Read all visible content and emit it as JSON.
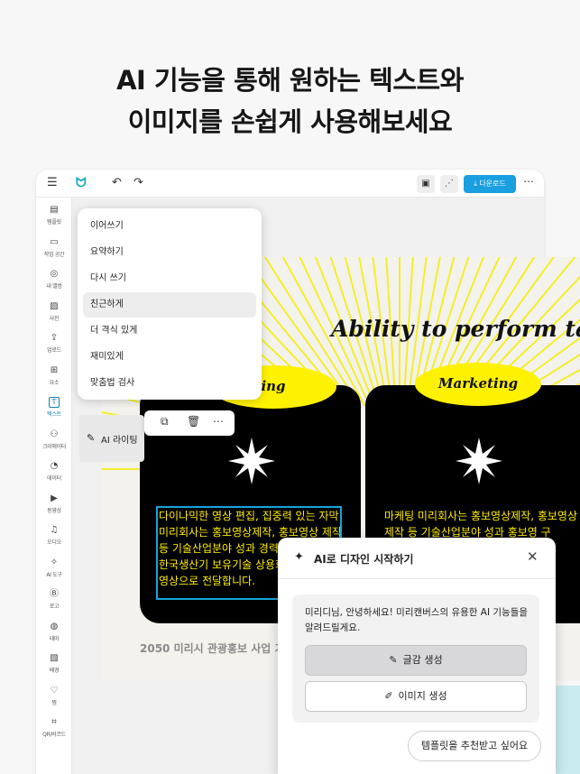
{
  "headline": {
    "line1": "AI 기능을 통해 원하는 텍스트와",
    "line2": "이미지를 손쉽게 사용해보세요"
  },
  "topbar": {
    "menu_icon": "☰",
    "logo_icon": "ᗢ",
    "undo_icon": "↶",
    "redo_icon": "↷",
    "save_icon": "▣",
    "share_icon": "⋰",
    "download_label": "⤓ 다운로드",
    "more_icon": "⋯"
  },
  "sidebar": {
    "items": [
      {
        "icon": "▤",
        "label": "템플릿"
      },
      {
        "icon": "▭",
        "label": "작업 공간"
      },
      {
        "icon": "◎",
        "label": "내 앨범"
      },
      {
        "icon": "▨",
        "label": "사진"
      },
      {
        "icon": "⇪",
        "label": "업로드"
      },
      {
        "icon": "⊞",
        "label": "요소"
      },
      {
        "icon": "T",
        "label": "텍스트"
      },
      {
        "icon": "⚇",
        "label": "크리에이터"
      },
      {
        "icon": "◔",
        "label": "데이터"
      },
      {
        "icon": "▶",
        "label": "동영상"
      },
      {
        "icon": "♫",
        "label": "오디오"
      },
      {
        "icon": "✧",
        "label": "AI 도구"
      },
      {
        "icon": "Ⓑ",
        "label": "로고"
      },
      {
        "icon": "◍",
        "label": "테마"
      },
      {
        "icon": "▧",
        "label": "배경"
      },
      {
        "icon": "♡",
        "label": "찜"
      },
      {
        "icon": "⌗",
        "label": "QR/바코드"
      }
    ]
  },
  "context_menu": {
    "items": [
      "이어쓰기",
      "요약하기",
      "다시 쓰기",
      "친근하게",
      "더 격식 있게",
      "재미있게",
      "맞춤법 검사"
    ],
    "highlighted": "친근하게"
  },
  "ai_write": {
    "icon": "✎",
    "label": "AI 라이팅"
  },
  "float_toolbar": {
    "dup_icon": "⧉",
    "delete_icon": "🗑",
    "more_icon": "⋯"
  },
  "artboard": {
    "title": "Ability to perform ta",
    "pill_left": "ing",
    "pill_right": "Marketing",
    "card_left_text": "다이나믹한 영상 편집, 집중력 있는 자막 미리회사는 홍보영상제작, 홍보영상 제작 등 기술산업분야 성과 경력을 바탕으로, 한국생산기 보유기술 상용화 및 사업화 영상으로 전달합니다.",
    "card_right_text": "마케팅 미리회사는 홍보영상제작, 홍보영상 제작 등 기술산업분야 성과 홍보영 구",
    "footer": "2050 미리시 관광홍보 사업 기"
  },
  "ai_panel": {
    "spark_icon": "✦",
    "title": "AI로 디자인 시작하기",
    "close_icon": "✕",
    "message": "미리디님, 안녕하세요! 미리캔버스의 유용한 AI 기능들을 알려드릴게요.",
    "btn_text_icon": "✎",
    "btn_text": "글감 생성",
    "btn_image_icon": "✐",
    "btn_image": "이미지 생성",
    "suggest": "템플릿을 추천받고 싶어요"
  },
  "colors": {
    "accent": "#1a9fe0",
    "selection": "#14a5d9",
    "highlight_yellow": "#fff200"
  }
}
